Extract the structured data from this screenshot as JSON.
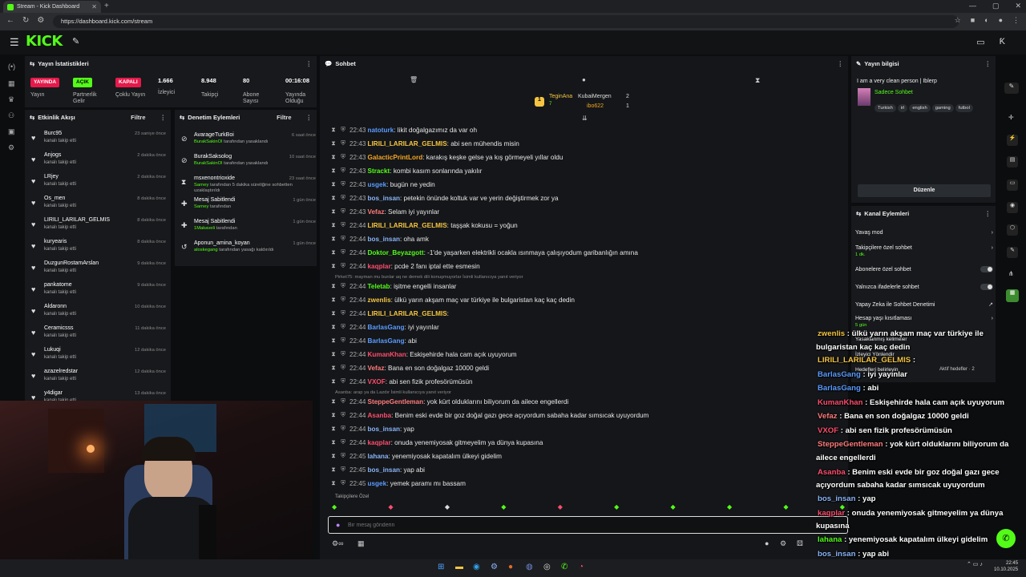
{
  "browser": {
    "tab_title": "Stream - Kick Dashboard",
    "url": "https://dashboard.kick.com/stream"
  },
  "brand": {
    "logo": "KICK"
  },
  "stats": {
    "title": "Yayın İstatistikleri",
    "live_badge": "YAYINDA",
    "open_badge": "AÇIK",
    "closed_badge": "KAPALI",
    "stream_label": "Yayın",
    "partner_label": "Partnerlik Gelir",
    "multi_label": "Çoklu Yayın",
    "viewers": "1.666",
    "viewers_label": "İzleyici",
    "followers": "8.948",
    "followers_label": "Takipçi",
    "subs": "80",
    "subs_label": "Abone Sayısı",
    "uptime": "00:16:08",
    "uptime_label": "Yayında Olduğu"
  },
  "activity": {
    "title": "Etkinlik Akışı",
    "filter": "Filtre",
    "items": [
      {
        "name": "Burc95",
        "sub": "kanalı takip etti",
        "time": "23 saniye önce"
      },
      {
        "name": "Anjogs",
        "sub": "kanalı takip etti",
        "time": "2 dakika önce"
      },
      {
        "name": "LRjey",
        "sub": "kanalı takip etti",
        "time": "2 dakika önce"
      },
      {
        "name": "Os_men",
        "sub": "kanalı takip etti",
        "time": "8 dakika önce"
      },
      {
        "name": "LIRILI_LARILAR_GELMIS",
        "sub": "kanalı takip etti",
        "time": "8 dakika önce"
      },
      {
        "name": "kuryearis",
        "sub": "kanalı takip etti",
        "time": "8 dakika önce"
      },
      {
        "name": "DuzgunRostamArslan",
        "sub": "kanalı takip etti",
        "time": "9 dakika önce"
      },
      {
        "name": "pankatome",
        "sub": "kanalı takip etti",
        "time": "9 dakika önce"
      },
      {
        "name": "Aldaronn",
        "sub": "kanalı takip etti",
        "time": "10 dakika önce"
      },
      {
        "name": "Ceramicsss",
        "sub": "kanalı takip etti",
        "time": "11 dakika önce"
      },
      {
        "name": "Lukuqi",
        "sub": "kanalı takip etti",
        "time": "12 dakika önce"
      },
      {
        "name": "azazelredstar",
        "sub": "kanalı takip etti",
        "time": "12 dakika önce"
      },
      {
        "name": "y4digar",
        "sub": "kanalı takip etti",
        "time": "13 dakika önce"
      }
    ]
  },
  "moderation": {
    "title": "Denetim Eylemleri",
    "filter": "Filtre",
    "items": [
      {
        "name": "AvarageTurkBoi",
        "who": "BurakSakinOl",
        "sub": "tarafından yasaklandı",
        "time": "6 saat önce"
      },
      {
        "name": "BurakSaksolog",
        "who": "BurakSakinOl",
        "sub": "tarafından yasaklandı",
        "time": "10 saat önce"
      },
      {
        "name": "msxenontrioxide",
        "who": "Sarney",
        "sub": "tarafından 5 dakika süreliğine sohbetten uzaklaştırıldı",
        "time": "23 saat önce"
      },
      {
        "name": "Mesaj Sabitlendi",
        "who": "Sarney",
        "sub": "tarafından",
        "time": "1 gün önce"
      },
      {
        "name": "Mesaj Sabitlendi",
        "who": "1Makaveli",
        "sub": "tarafından",
        "time": "1 gün önce"
      },
      {
        "name": "Aponun_amina_koyan",
        "who": "aloskegang",
        "sub": "tarafından yasağı kaldırıldı",
        "time": "1 gün önce"
      }
    ]
  },
  "chat": {
    "title": "Sohbet",
    "top_users": [
      {
        "name": "TeginAna",
        "count": "7"
      },
      {
        "name": "KubaiMergen",
        "count": "2"
      },
      {
        "name": "ibo622",
        "count": "1"
      }
    ],
    "messages": [
      {
        "time": "22:43",
        "user": "natoturk",
        "color": "#5b9bff",
        "text": ": likit doğalgazımız da var oh"
      },
      {
        "time": "22:43",
        "user": "LIRILI_LARILAR_GELMIS",
        "color": "#f5c542",
        "text": ": abi sen mühendis misin"
      },
      {
        "time": "22:43",
        "user": "GalacticPrintLord",
        "color": "#f5a623",
        "text": ": karakış keşke gelse ya kış görmeyeli yıllar oldu"
      },
      {
        "time": "22:43",
        "user": "Strackt",
        "color": "#53fc18",
        "text": ": kombi kasım sonlarında yakılır"
      },
      {
        "time": "22:43",
        "user": "usgek",
        "color": "#5b9bff",
        "text": ": bugün ne yedin"
      },
      {
        "time": "22:43",
        "user": "bos_insan",
        "color": "#8ab4f8",
        "text": ": petekin önünde koltuk var ve yerin değiştirmek zor ya"
      },
      {
        "time": "22:43",
        "user": "Vefaz",
        "color": "#ff7b7b",
        "text": ": Selam iyi yayınlar"
      },
      {
        "time": "22:44",
        "user": "LIRILI_LARILAR_GELMIS",
        "color": "#f5c542",
        "text": ": taşşak kokusu = yoğun"
      },
      {
        "time": "22:44",
        "user": "bos_insan",
        "color": "#8ab4f8",
        "text": ": oha amk"
      },
      {
        "time": "22:44",
        "user": "Doktor_Beyazgott",
        "color": "#53fc18",
        "text": ": -1'de yaşarken elektrikli ocakla ısınmaya çalışıyodum garibanlığın amına"
      },
      {
        "time": "22:44",
        "user": "kaqplar",
        "color": "#ff4d6d",
        "text": ": pcde 2 fanı iptal ette esmesin"
      },
      {
        "time": "22:44",
        "user": "Teletab",
        "color": "#53fc18",
        "text": ": işitme engelli insanlar"
      },
      {
        "time": "22:44",
        "user": "zwenlis",
        "color": "#f5c542",
        "text": ": ülkü yarın akşam maç var türkiye ile bulgaristan kaç kaç dedin"
      },
      {
        "time": "22:44",
        "user": "LIRILI_LARILAR_GELMIS",
        "color": "#f5c542",
        "text": ":"
      },
      {
        "time": "22:44",
        "user": "BarlasGang",
        "color": "#5b9bff",
        "text": ": iyi yayınlar"
      },
      {
        "time": "22:44",
        "user": "BarlasGang",
        "color": "#5b9bff",
        "text": ": abi"
      },
      {
        "time": "22:44",
        "user": "KumanKhan",
        "color": "#ff4d6d",
        "text": ": Eskişehirde hala cam açık uyuyorum"
      },
      {
        "time": "22:44",
        "user": "Vefaz",
        "color": "#ff7b7b",
        "text": ": Bana en son doğalgaz 10000 geldi"
      },
      {
        "time": "22:44",
        "user": "VXOF",
        "color": "#ff4d6d",
        "text": ": abi sen fizik profesörümüsün"
      },
      {
        "time": "22:44",
        "user": "SteppeGentleman",
        "color": "#ff7b7b",
        "text": ": yok kürt olduklarını biliyorum da ailece engellerdi"
      },
      {
        "time": "22:44",
        "user": "Asanba",
        "color": "#ff4d6d",
        "text": ": Benim eski evde bir goz doğal gazı gece açıyordum sabaha kadar sımsıcak uyuyordum"
      },
      {
        "time": "22:44",
        "user": "bos_insan",
        "color": "#8ab4f8",
        "text": ": yap"
      },
      {
        "time": "22:44",
        "user": "kaqplar",
        "color": "#ff4d6d",
        "text": ": onuda yenemiyosak gitmeyelim ya dünya kupasına"
      },
      {
        "time": "22:45",
        "user": "lahana",
        "color": "#8ab4f8",
        "text": ": yenemiyosak kapatalım ülkeyi gidelim"
      },
      {
        "time": "22:45",
        "user": "bos_insan",
        "color": "#8ab4f8",
        "text": ": yap abi"
      },
      {
        "time": "22:45",
        "user": "usgek",
        "color": "#5b9bff",
        "text": ": yemek paramı mı bassam"
      }
    ],
    "reply1": "Pirket75: mayman mu bunlar aq ne demek dili konuşmuyorlar İsimli kullanıcıya yanıt veriyor",
    "reply2": "Asanba: arap ya da Lazdır İsimli kullanıcıya yanıt veriyor",
    "followers_only": "Takipçilere Özel",
    "input_placeholder": "Bir mesaj gönderin"
  },
  "stream_info": {
    "title": "Yayın bilgisi",
    "stream_title": "I am a very clean person | Iblerp",
    "category": "Sadece Sohbet",
    "tags": [
      "Turkish",
      "irl",
      "english",
      "gaming",
      "futbol"
    ],
    "edit_button": "Düzenle"
  },
  "channel_actions": {
    "title": "Kanal Eylemleri",
    "slow_mode": "Yavaş mod",
    "followers_chat": "Takipçilere özel sohbet",
    "followers_chat_sub": "1 dk.",
    "subs_chat": "Abonelere özel sohbet",
    "emotes_chat": "Yalnızca ifadelerle sohbet",
    "ai_moderation": "Yapay Zeka ile Sohbet Denetimi",
    "account_age": "Hesap yaşı kısıtlaması",
    "account_age_sub": "5 gün",
    "banned_words": "Yasaklanmış kelimeler",
    "viewer_redirect": "İzleyici Yönlendir",
    "goal": "Hedefleri belirleyin",
    "active_goals": "Aktif hedefler · 2"
  },
  "overlay": {
    "lines": [
      {
        "user": "zwenlis",
        "color": "#f5c542",
        "text": " : ülkü yarın akşam maç var türkiye ile"
      },
      {
        "user": "",
        "color": "#fff",
        "text": "bulgaristan kaç kaç dedin"
      },
      {
        "user": "LIRILI_LARILAR_GELMIS",
        "color": "#f5c542",
        "text": " :"
      },
      {
        "user": "BarlasGang",
        "color": "#5b9bff",
        "text": " : iyi yayınlar"
      },
      {
        "user": "BarlasGang",
        "color": "#5b9bff",
        "text": " : abi"
      },
      {
        "user": "KumanKhan",
        "color": "#ff4d6d",
        "text": " : Eskişehirde hala cam açık uyuyorum"
      },
      {
        "user": "Vefaz",
        "color": "#ff7b7b",
        "text": " : Bana en son doğalgaz 10000 geldi"
      },
      {
        "user": "VXOF",
        "color": "#ff4d6d",
        "text": " : abi sen fizik profesörümüsün"
      },
      {
        "user": "SteppeGentleman",
        "color": "#ff7b7b",
        "text": " : yok kürt olduklarını biliyorum da"
      },
      {
        "user": "",
        "color": "#fff",
        "text": "ailece engellerdi"
      },
      {
        "user": "Asanba",
        "color": "#ff4d6d",
        "text": " : Benim eski evde bir goz doğal gazı gece"
      },
      {
        "user": "",
        "color": "#fff",
        "text": "açıyordum sabaha kadar sımsıcak uyuyordum"
      },
      {
        "user": "bos_insan",
        "color": "#8ab4f8",
        "text": " : yap"
      },
      {
        "user": "kaqplar",
        "color": "#ff4d6d",
        "text": " : onuda yenemiyosak gitmeyelim ya dünya"
      },
      {
        "user": "",
        "color": "#fff",
        "text": "kupasına"
      },
      {
        "user": "lahana",
        "color": "#53fc18",
        "text": " : yenemiyosak kapatalım ülkeyi gidelim"
      },
      {
        "user": "bos_insan",
        "color": "#8ab4f8",
        "text": " : yap abi"
      },
      {
        "user": "usgek",
        "color": "#5b9bff",
        "text": " : yemek paramı mı bassam"
      }
    ]
  },
  "clock": {
    "time": "22:45",
    "date": "10.10.2025"
  },
  "colors": {
    "accent": "#53fc18",
    "panel": "#17191c",
    "bg": "#0b0d0f",
    "live": "#e6194b"
  }
}
